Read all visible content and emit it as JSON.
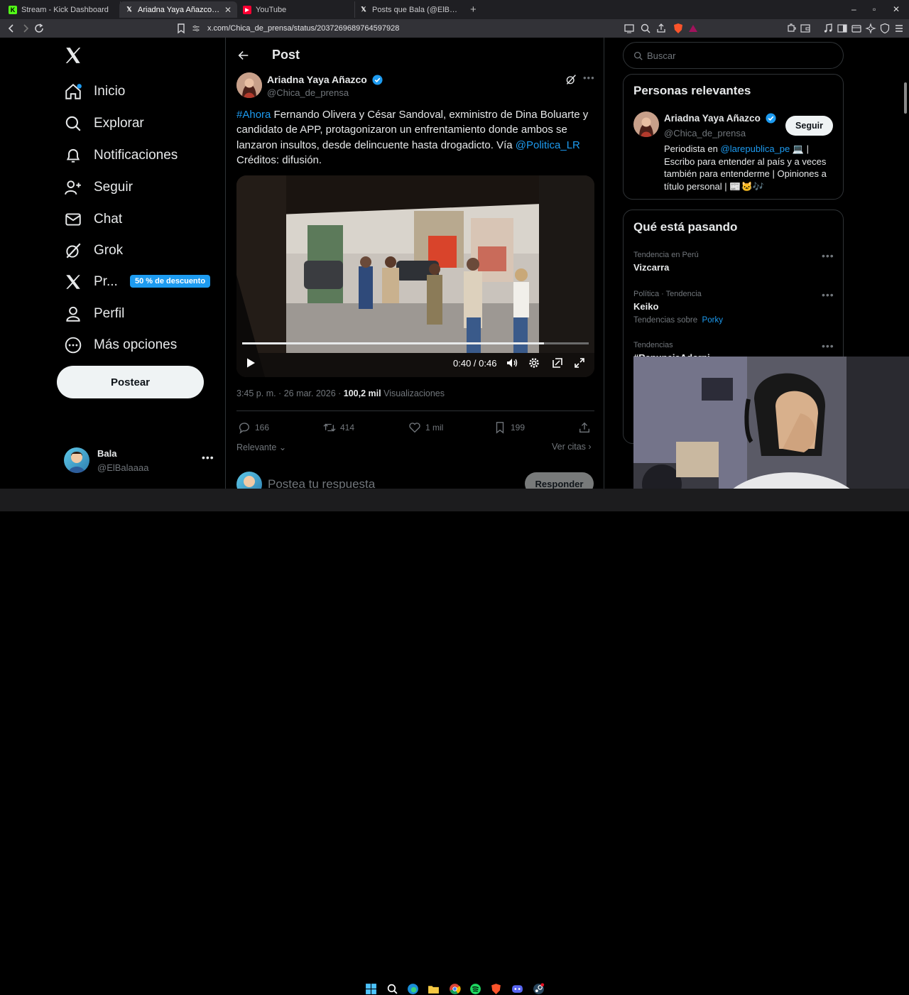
{
  "browser": {
    "tabs": [
      {
        "title": "Stream - Kick Dashboard",
        "active": false
      },
      {
        "title": "Ariadna Yaya Añazco en X: \"#Ahora",
        "active": true
      },
      {
        "title": "YouTube",
        "active": false
      },
      {
        "title": "Posts que Bala (@ElBalaaaa) ha indicado",
        "active": false
      }
    ],
    "url": "x.com/Chica_de_prensa/status/2037269689764597928"
  },
  "nav": {
    "items": [
      {
        "label": "Inicio",
        "icon": "home-icon"
      },
      {
        "label": "Explorar",
        "icon": "search-icon"
      },
      {
        "label": "Notificaciones",
        "icon": "bell-icon"
      },
      {
        "label": "Seguir",
        "icon": "add-person-icon"
      },
      {
        "label": "Chat",
        "icon": "mail-icon"
      },
      {
        "label": "Grok",
        "icon": "grok-icon"
      },
      {
        "label": "Pr...",
        "icon": "x-premium-icon"
      },
      {
        "label": "Perfil",
        "icon": "person-icon"
      },
      {
        "label": "Más opciones",
        "icon": "more-circle-icon"
      }
    ],
    "promo_badge": "50 % de descuento",
    "post_button": "Postear",
    "me": {
      "name": "Bala",
      "handle": "@ElBalaaaa"
    }
  },
  "post": {
    "header_title": "Post",
    "author_name": "Ariadna Yaya Añazco",
    "author_handle": "@Chica_de_prensa",
    "text_hashtag": "#Ahora",
    "text_body": " Fernando Olivera y César Sandoval, exministro de Dina Boluarte y candidato de APP, protagonizaron un enfrentamiento donde ambos se lanzaron insultos, desde delincuente hasta drogadicto. Vía ",
    "text_mention": "@Politica_LR",
    "text_credits": "Créditos: difusión.",
    "video_time": "0:40 / 0:46",
    "video_progress": 0.87,
    "timestamp": "3:45 p. m. · 26 mar. 2026 · ",
    "views_count": "100,2 mil",
    "views_label": " Visualizaciones",
    "replies": "166",
    "reposts": "414",
    "likes": "1 mil",
    "bookmarks": "199",
    "sort_label": "Relevante",
    "quotes_label": "Ver citas",
    "reply_placeholder": "Postea tu respuesta",
    "reply_button": "Responder"
  },
  "sidebar": {
    "search_placeholder": "Buscar",
    "relevant_title": "Personas relevantes",
    "person_name": "Ariadna Yaya Añazco",
    "person_handle": "@Chica_de_prensa",
    "follow_label": "Seguir",
    "bio_prefix": "Periodista en ",
    "bio_link": "@larepublica_pe",
    "bio_rest": " 💻 | Escribo para entender al país y a veces también para entenderme | Opiniones a título personal | 📰🐱🎶",
    "trends_title": "Qué está pasando",
    "trends": [
      {
        "label": "Tendencia en Perú",
        "name": "Vizcarra"
      },
      {
        "label": "Política · Tendencia",
        "name": "Keiko",
        "extra_label": "Tendencias sobre",
        "extra_link": "Porky"
      },
      {
        "label": "Tendencias",
        "name": "#RenunciaAdorni"
      }
    ]
  },
  "colors": {
    "accent": "#1d9bf0",
    "background": "#000000",
    "border": "#2f3336",
    "muted": "#71767b"
  }
}
